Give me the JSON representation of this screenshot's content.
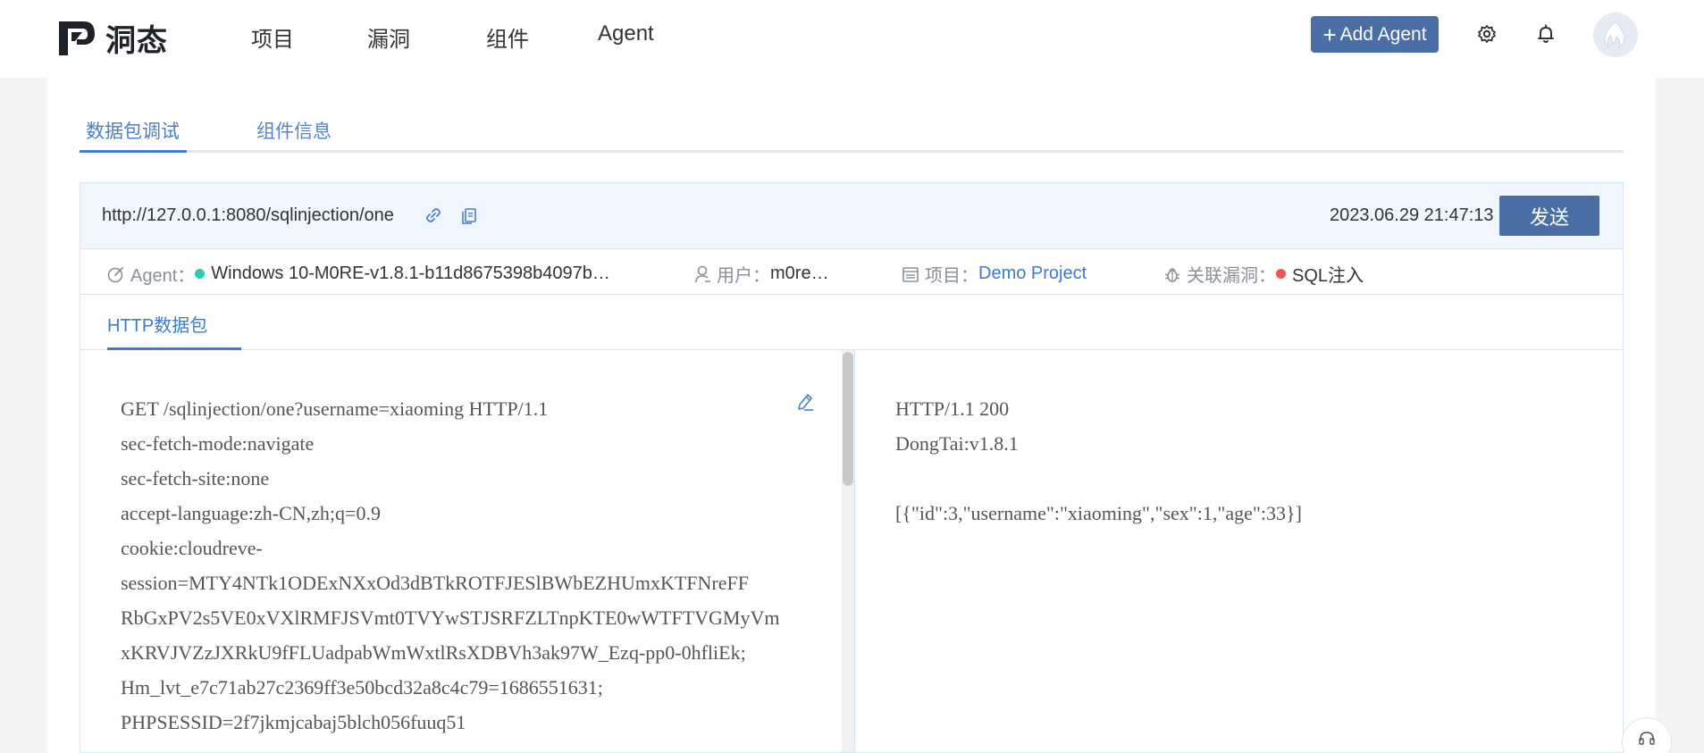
{
  "brand": {
    "name": "洞态"
  },
  "nav": {
    "items": [
      {
        "label": "项目"
      },
      {
        "label": "漏洞"
      },
      {
        "label": "组件"
      },
      {
        "label": "Agent"
      }
    ],
    "add_agent_label": "Add Agent"
  },
  "icons": {
    "settings": "gear-icon",
    "notifications": "bell-icon",
    "avatar": "flame-icon"
  },
  "tabs": [
    {
      "label": "数据包调试",
      "active": true
    },
    {
      "label": "组件信息",
      "active": false
    }
  ],
  "request": {
    "url": "http://127.0.0.1:8080/sqlinjection/one",
    "timestamp": "2023.06.29 21:47:13",
    "send_label": "发送"
  },
  "meta": {
    "agent_label": "Agent：",
    "agent_value": "Windows 10-M0RE-v1.8.1-b11d8675398b4097b…",
    "agent_status_color": "#2ecbb0",
    "user_label": "用户：",
    "user_value": "m0re…",
    "project_label": "项目：",
    "project_value": "Demo Project",
    "vuln_label": "关联漏洞：",
    "vuln_value": "SQL注入",
    "vuln_status_color": "#f05454"
  },
  "sub_tab": {
    "label": "HTTP数据包"
  },
  "request_packet": {
    "lines": [
      "GET /sqlinjection/one?username=xiaoming HTTP/1.1",
      "sec-fetch-mode:navigate",
      "sec-fetch-site:none",
      "accept-language:zh-CN,zh;q=0.9",
      "cookie:cloudreve-",
      "session=MTY4NTk1ODExNXxOd3dBTkROTFJESlBWbEZHUmxKTFNreFF",
      "RbGxPV2s5VE0xVXlRMFJSVmt0TVYwSTJSRFZLTnpKTE0wWTFTVGMyVm",
      "xKRVJVZzJXRkU9fFLUadpabWmWxtlRsXDBVh3ak97W_Ezq-pp0-0hfliEk;",
      "Hm_lvt_e7c71ab27c2369ff3e50bcd32a8c4c79=1686551631;",
      "PHPSESSID=2f7jkmjcabaj5blch056fuuq51"
    ]
  },
  "response_packet": {
    "lines": [
      "HTTP/1.1 200",
      "DongTai:v1.8.1",
      "",
      "[{\"id\":3,\"username\":\"xiaoming\",\"sex\":1,\"age\":33}]"
    ]
  },
  "colors": {
    "primary_button": "#4a6fa5",
    "accent_blue": "#3a7bd5",
    "url_bar_bg": "#f0f6fd"
  }
}
